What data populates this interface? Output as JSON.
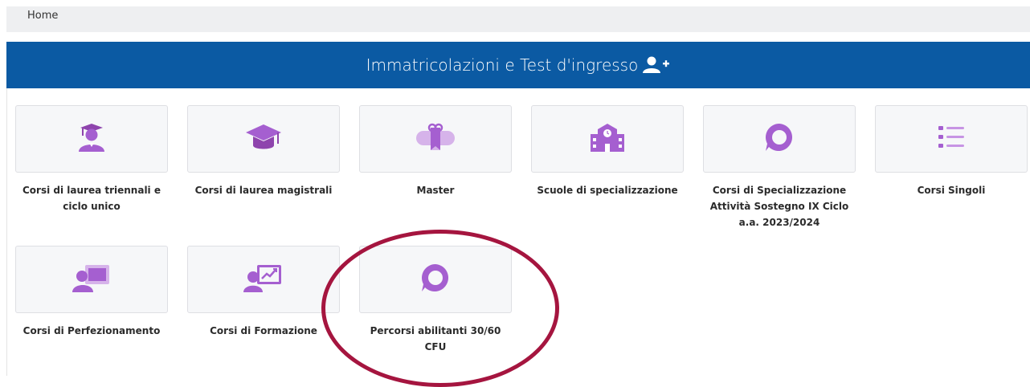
{
  "breadcrumb": {
    "home": "Home"
  },
  "header": {
    "title": "Immatricolazioni e Test d'ingresso",
    "icon": "add-user-icon"
  },
  "colors": {
    "header_bg": "#0b5aa3",
    "icon": "#9b59d0",
    "highlight": "#a5153f"
  },
  "tiles": [
    {
      "label": "Corsi di laurea triennali e ciclo unico",
      "icon": "graduate-icon"
    },
    {
      "label": "Corsi di laurea magistrali",
      "icon": "mortarboard-icon"
    },
    {
      "label": "Master",
      "icon": "diploma-icon"
    },
    {
      "label": "Scuole di specializzazione",
      "icon": "school-icon"
    },
    {
      "label": "Corsi di Specializzazione Attività Sostegno IX Ciclo a.a. 2023/2024",
      "icon": "speech-bubble-icon"
    },
    {
      "label": "Corsi Singoli",
      "icon": "list-icon"
    },
    {
      "label": "Corsi di Perfezionamento",
      "icon": "teacher-board-icon"
    },
    {
      "label": "Corsi di Formazione",
      "icon": "presentation-chart-icon"
    },
    {
      "label": "Percorsi abilitanti 30/60 CFU",
      "icon": "speech-bubble-icon"
    }
  ]
}
